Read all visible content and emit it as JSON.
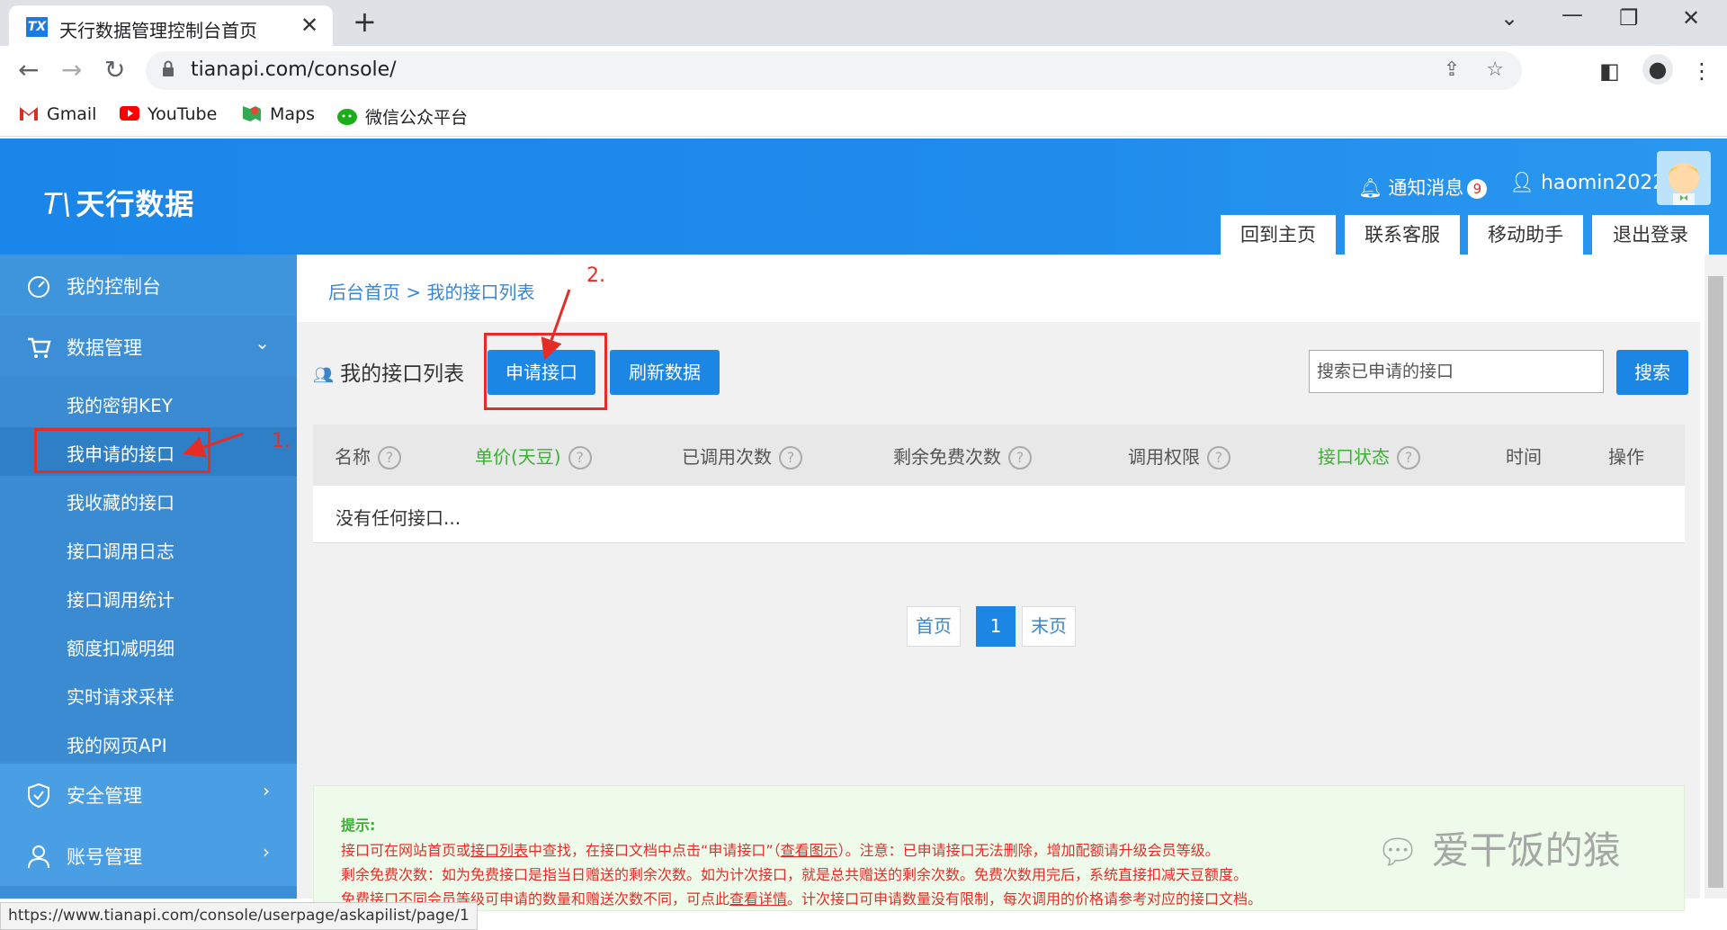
{
  "browser": {
    "tab_title": "天行数据管理控制台首页",
    "tab_icon": "tianapi-favicon",
    "url": "tianapi.com/console/",
    "bookmarks": [
      {
        "label": "Gmail",
        "icon": "gmail-icon"
      },
      {
        "label": "YouTube",
        "icon": "youtube-icon"
      },
      {
        "label": "Maps",
        "icon": "maps-icon"
      },
      {
        "label": "微信公众平台",
        "icon": "wechat-icon"
      }
    ],
    "status_url": "https://www.tianapi.com/console/userpage/askapilist/page/1"
  },
  "header": {
    "logo_mark": "T\\",
    "logo_text": "天行数据",
    "notify_label": "通知消息",
    "notify_count": "9",
    "username": "haomin2022",
    "nav_buttons": [
      "回到主页",
      "联系客服",
      "移动助手",
      "退出登录"
    ]
  },
  "sidebar": {
    "dashboard": "我的控制台",
    "data_mgmt": "数据管理",
    "sub_items": [
      "我的密钥KEY",
      "我申请的接口",
      "我收藏的接口",
      "接口调用日志",
      "接口调用统计",
      "额度扣减明细",
      "实时请求采样",
      "我的网页API"
    ],
    "security": "安全管理",
    "account": "账号管理"
  },
  "main": {
    "breadcrumb_home": "后台首页",
    "breadcrumb_sep": ">",
    "breadcrumb_current": "我的接口列表",
    "list_title": "我的接口列表",
    "apply_button": "申请接口",
    "refresh_button": "刷新数据",
    "search_placeholder": "搜索已申请的接口",
    "search_button": "搜索",
    "columns": [
      "名称",
      "单价(天豆)",
      "已调用次数",
      "剩余免费次数",
      "调用权限",
      "接口状态",
      "时间",
      "操作"
    ],
    "empty_text": "没有任何接口...",
    "pagination": [
      "首页",
      "1",
      "末页"
    ]
  },
  "tips": {
    "title": "提示:",
    "line1_a": "接口可在网站首页或",
    "line1_link1": "接口列表",
    "line1_b": "中查找，在接口文档中点击“申请接口”（",
    "line1_link2": "查看图示",
    "line1_c": "）。注意：已申请接口无法删除，增加配额请升级会员等级。",
    "line2": "剩余免费次数：如为免费接口是指当日赠送的剩余次数。如为计次接口，就是总共赠送的剩余次数。免费次数用完后，系统直接扣减天豆额度。",
    "line3_a": "免费接口不同会员等级可申请的数量和赠送次数不同，可点此",
    "line3_link": "查看详情",
    "line3_b": "。计次接口可申请数量没有限制，每次调用的价格请参考对应的接口文档。"
  },
  "annotations": {
    "step1": "1.",
    "step2": "2."
  },
  "watermark": "爱干饭的猿",
  "colors": {
    "brand_blue": "#1c86e4",
    "sidebar": "#3c8fd6",
    "sidebar_active": "#2f7fc6",
    "annotation_red": "#e52d27",
    "status_green": "#3cb034"
  }
}
